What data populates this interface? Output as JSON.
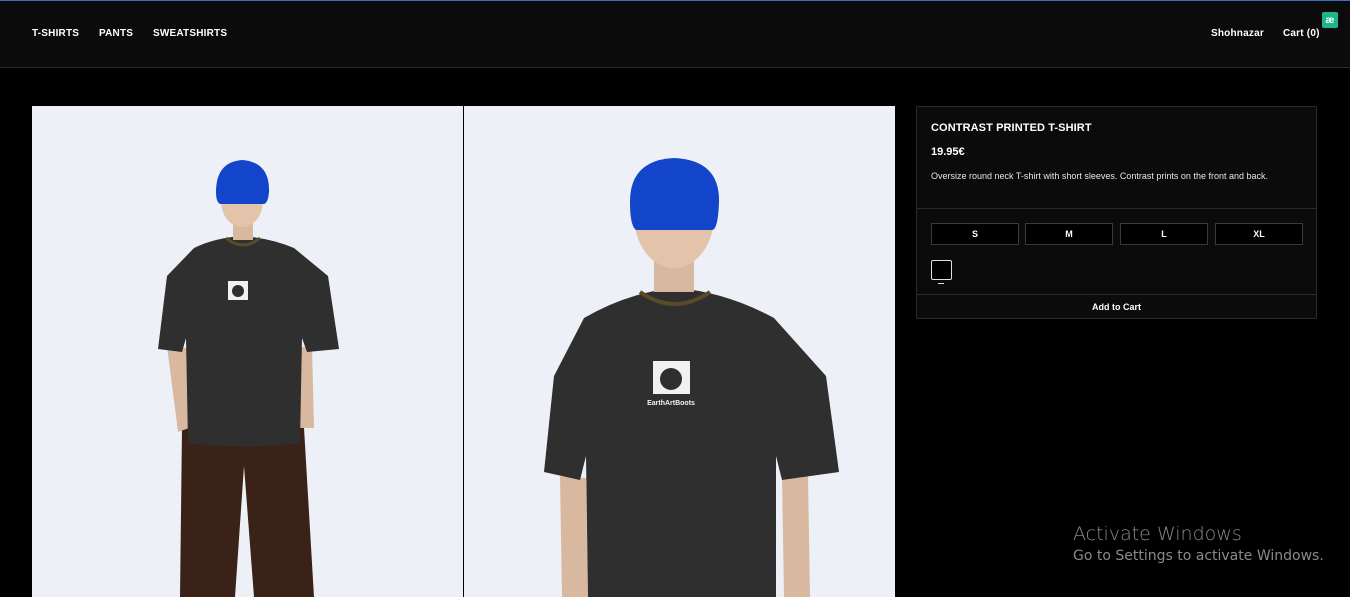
{
  "header": {
    "nav": [
      {
        "label": "T-SHIRTS"
      },
      {
        "label": "PANTS"
      },
      {
        "label": "SWEATSHIRTS"
      }
    ],
    "user_name": "Shohnazar",
    "cart_label": "Cart (0)",
    "extension_badge": "æ"
  },
  "product": {
    "title": "CONTRAST PRINTED T-SHIRT",
    "price": "19.95€",
    "description": "Oversize round neck T-shirt with short sleeves. Contrast prints on the front and back.",
    "sizes": [
      "S",
      "M",
      "L",
      "XL"
    ],
    "color_swatch": "#000000",
    "add_to_cart_label": "Add to Cart",
    "print_caption": "EarthArtBoots"
  },
  "colors": {
    "shirt": "#2f2f2f",
    "beanie": "#1245c9",
    "pants": "#3a2218",
    "photo_bg": "#eef0f7"
  },
  "watermark": {
    "title": "Activate Windows",
    "subtitle": "Go to Settings to activate Windows."
  }
}
